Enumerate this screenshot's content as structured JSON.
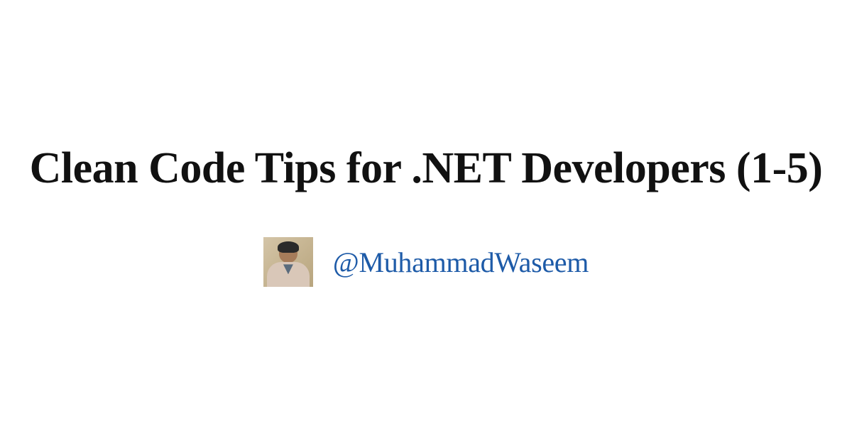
{
  "title": "Clean Code Tips for .NET Developers (1-5)",
  "author": {
    "handle": "@MuhammadWaseem"
  },
  "colors": {
    "title": "#111111",
    "handle": "#1e5ba8",
    "background": "#ffffff"
  }
}
